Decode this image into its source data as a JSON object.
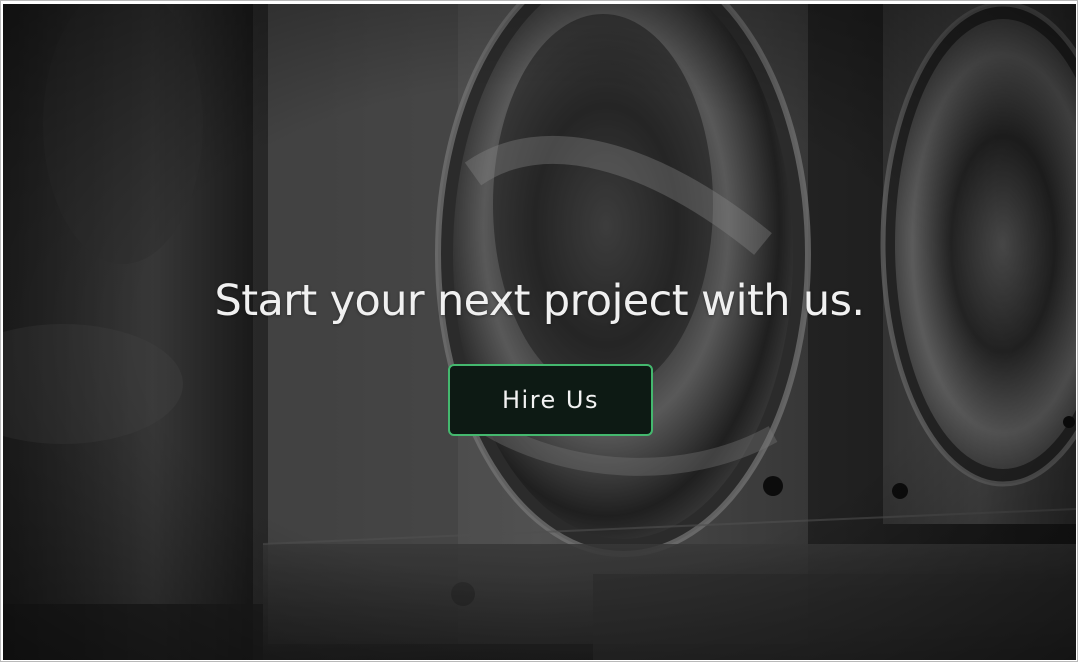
{
  "hero": {
    "title": "Start your next project with us.",
    "button_label": "Hire Us",
    "background_image": "dark-machined-metal-parts-photo"
  },
  "colors": {
    "button_border": "#44b86e",
    "button_background": "#0d1a14",
    "text": "#f0f0f0"
  }
}
